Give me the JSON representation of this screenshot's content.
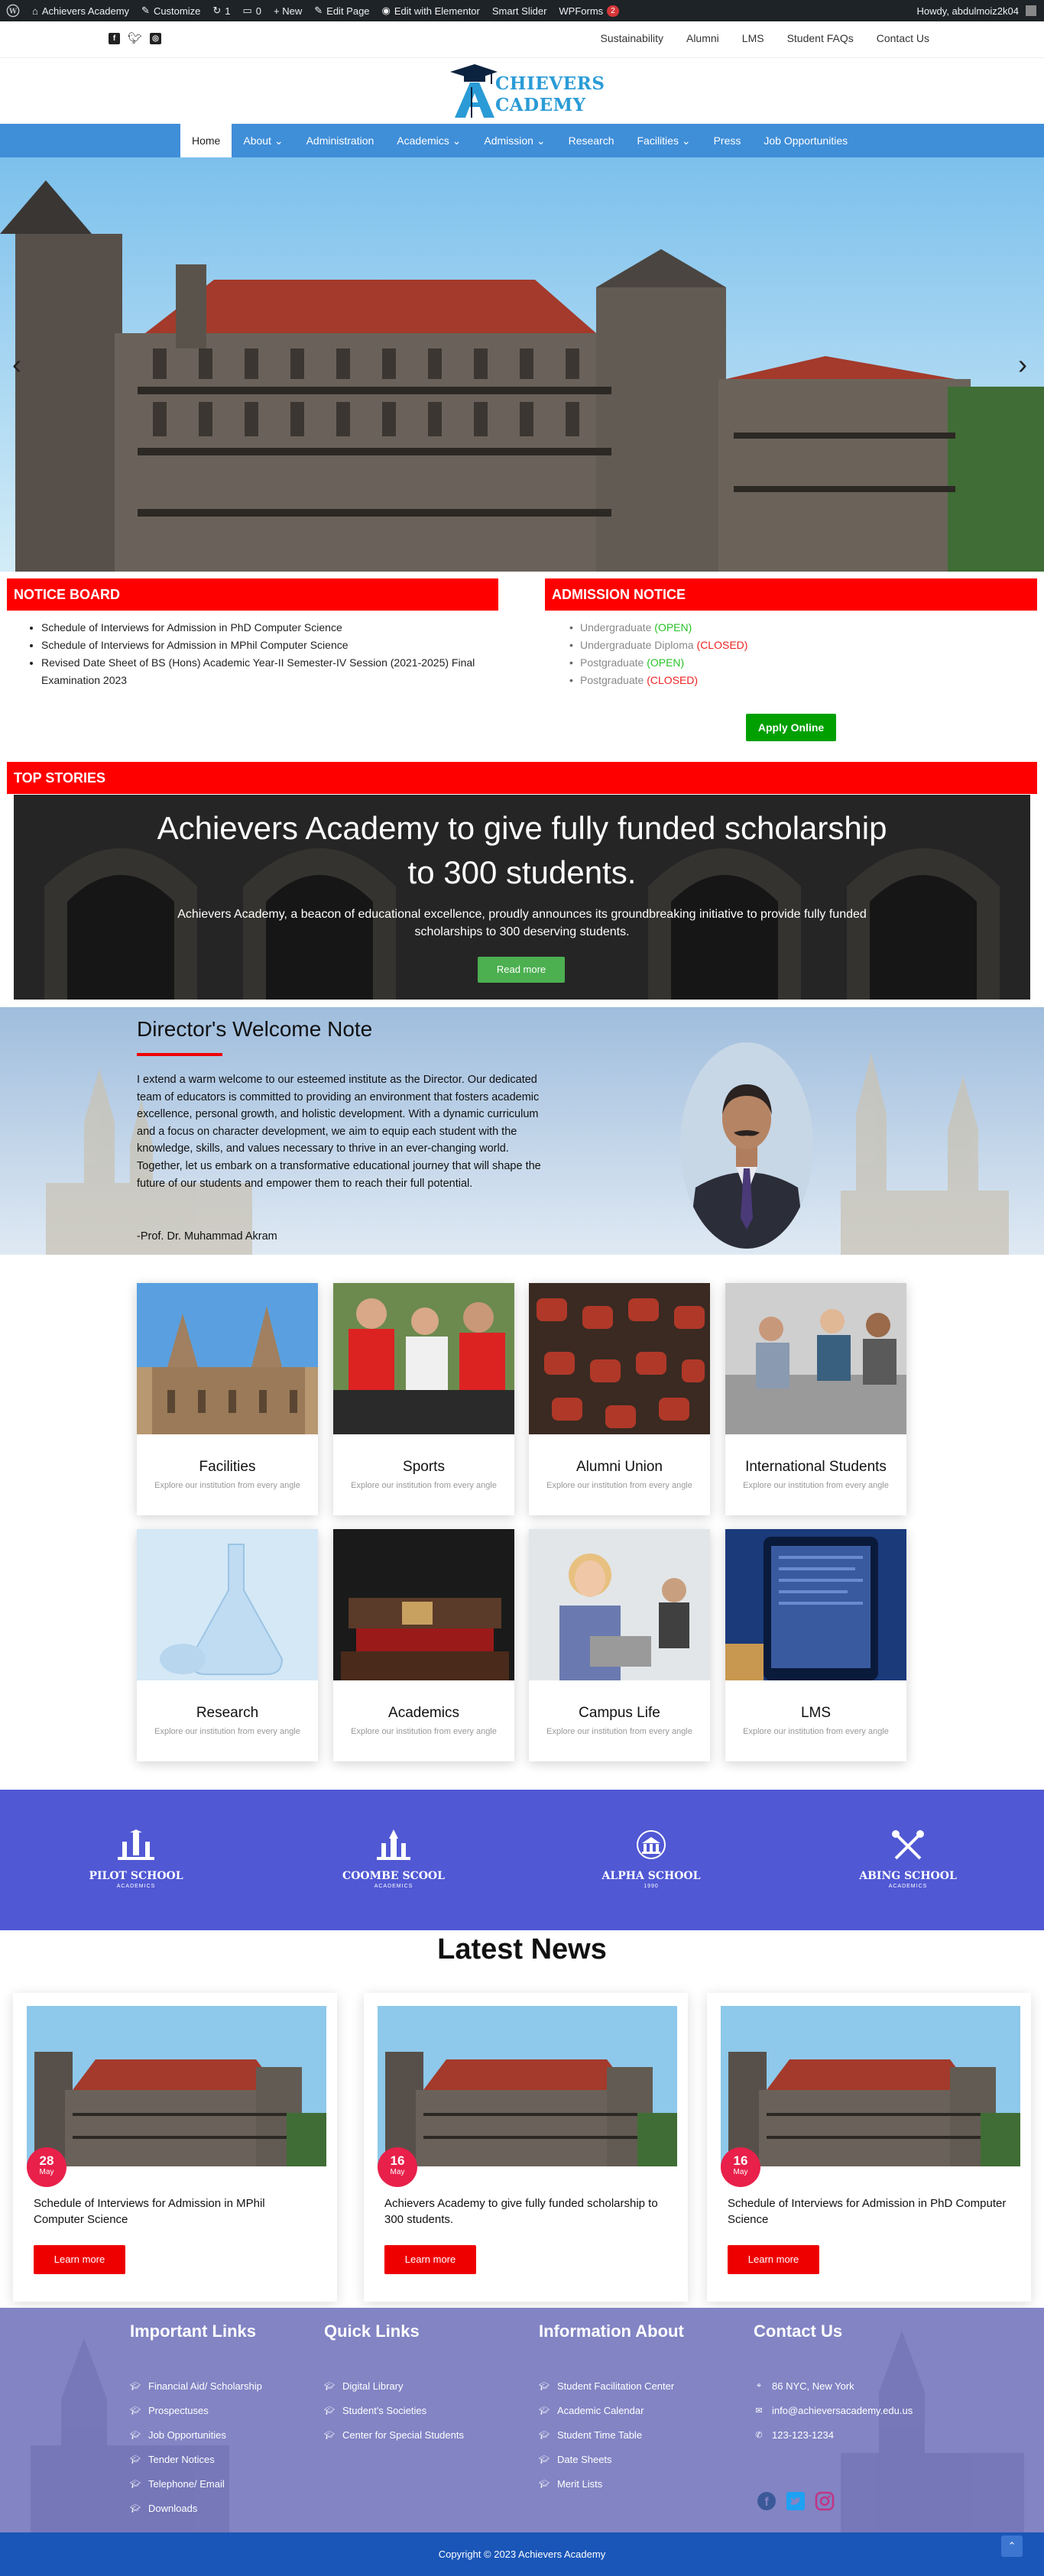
{
  "admin_bar": {
    "site_name": "Achievers Academy",
    "customize": "Customize",
    "updates": "1",
    "comments": "0",
    "new": "+ New",
    "edit_page": "Edit Page",
    "elementor": "Edit with Elementor",
    "smart_slider": "Smart Slider",
    "wpforms": "WPForms",
    "wpforms_badge": "2",
    "howdy": "Howdy, abdulmoiz2k04"
  },
  "top_menu": [
    "Sustainability",
    "Alumni",
    "LMS",
    "Student FAQs",
    "Contact Us"
  ],
  "logo": {
    "line1": "CHIEVERS",
    "line2": "CADEMY"
  },
  "nav": {
    "items": [
      {
        "label": "Home"
      },
      {
        "label": "About ⌄"
      },
      {
        "label": "Administration"
      },
      {
        "label": "Academics ⌄"
      },
      {
        "label": "Admission ⌄"
      },
      {
        "label": "Research"
      },
      {
        "label": "Facilities ⌄"
      },
      {
        "label": "Press"
      },
      {
        "label": "Job Opportunities"
      }
    ]
  },
  "slider": {
    "prev": "‹",
    "next": "›"
  },
  "notice_board": {
    "title": "NOTICE BOARD",
    "items": [
      "Schedule of Interviews for Admission in PhD Computer Science",
      "Schedule of Interviews for Admission in MPhil Computer Science",
      "Revised Date Sheet of BS (Hons) Academic Year-II Semester-IV Session (2021-2025) Final Examination 2023"
    ]
  },
  "admission_notice": {
    "title": "ADMISSION NOTICE",
    "items": [
      {
        "label": "Undergraduate",
        "status": "(OPEN)",
        "color": "#27c227"
      },
      {
        "label": "Undergraduate Diploma",
        "status": "(CLOSED)",
        "color": "#e22222"
      },
      {
        "label": "Postgraduate",
        "status": "(OPEN)",
        "color": "#27c227"
      },
      {
        "label": "Postgraduate",
        "status": "(CLOSED)",
        "color": "#e22222"
      }
    ],
    "apply_label": "Apply Online"
  },
  "top_stories": {
    "title": "TOP STORIES",
    "headline": "Achievers Academy to give fully funded scholarship to 300 students.",
    "description": "Achievers Academy, a beacon of educational excellence, proudly announces its groundbreaking initiative to provide fully funded scholarships to 300 deserving students.",
    "button": "Read more"
  },
  "director": {
    "title": "Director's Welcome Note",
    "text": "I extend a warm welcome to our esteemed institute as the Director. Our dedicated team of educators is committed to providing an environment that fosters academic excellence, personal growth, and holistic development. With a dynamic curriculum and a focus on character development, we aim to equip each student with the knowledge, skills, and values necessary to thrive in an ever-changing world. Together, let us embark on a transformative educational journey that will shape the future of our students and empower them to reach their full potential.",
    "signature": "-Prof. Dr. Muhammad Akram"
  },
  "cards": [
    {
      "title": "Facilities",
      "subtitle": "Explore our institution from every angle"
    },
    {
      "title": "Sports",
      "subtitle": "Explore our institution from every angle"
    },
    {
      "title": "Alumni Union",
      "subtitle": "Explore our institution from every angle"
    },
    {
      "title": "International Students",
      "subtitle": "Explore our institution from every angle"
    },
    {
      "title": "Research",
      "subtitle": "Explore our institution from every angle"
    },
    {
      "title": "Academics",
      "subtitle": "Explore our institution from every angle"
    },
    {
      "title": "Campus Life",
      "subtitle": "Explore our institution from every angle"
    },
    {
      "title": "LMS",
      "subtitle": "Explore our institution from every angle"
    }
  ],
  "partners": [
    {
      "name": "PILOT SCHOOL",
      "sub": "ACADEMICS"
    },
    {
      "name": "COOMBE SCOOL",
      "sub": "ACADEMICS"
    },
    {
      "name": "ALPHA SCHOOL",
      "sub": "1990"
    },
    {
      "name": "ABING SCHOOL",
      "sub": "ACADEMICS"
    }
  ],
  "news": {
    "title": "Latest News",
    "items": [
      {
        "day": "28",
        "month": "May",
        "title": "Schedule of Interviews for Admission in MPhil Computer Science",
        "button": "Learn more"
      },
      {
        "day": "16",
        "month": "May",
        "title": "Achievers Academy to give fully funded scholarship to 300 students.",
        "button": "Learn more"
      },
      {
        "day": "16",
        "month": "May",
        "title": "Schedule of Interviews for Admission in PhD Computer Science",
        "button": "Learn more"
      }
    ]
  },
  "footer": {
    "important": {
      "title": "Important Links",
      "items": [
        "Financial Aid/ Scholarship",
        "Prospectuses",
        "Job Opportunities",
        "Tender Notices",
        "Telephone/ Email",
        "Downloads"
      ]
    },
    "quick": {
      "title": "Quick Links",
      "items": [
        "Digital Library",
        "Student's Societies",
        "Center for Special Students"
      ]
    },
    "info": {
      "title": "Information About",
      "items": [
        "Student Facilitation Center",
        "Academic Calendar",
        "Student Time Table",
        "Date Sheets",
        "Merit Lists"
      ]
    },
    "contact": {
      "title": "Contact Us",
      "address": "86 NYC, New York",
      "email": "info@achieversacademy.edu.us",
      "phone": "123-123-1234"
    },
    "social_colors": {
      "facebook": "#3b5998",
      "twitter": "#1da1f2",
      "instagram": "#c13584"
    }
  },
  "copyright": "Copyright © 2023 Achievers Academy",
  "colors": {
    "nav": "#3f8ed8",
    "notice_red": "#ff0000",
    "partners_bg": "#5058d4",
    "footer_bg": "#8284c4",
    "copyright_bg": "#1a56b8",
    "date_badge": "#e8204a"
  }
}
